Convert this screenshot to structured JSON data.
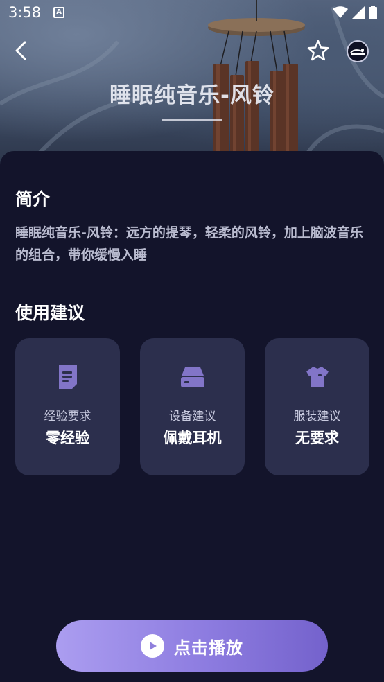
{
  "status_bar": {
    "time": "3:58",
    "notification_glyph": "A",
    "icons": [
      "wifi-icon",
      "signal-icon",
      "battery-icon"
    ]
  },
  "header": {
    "title": "睡眠纯音乐-风铃",
    "back_icon": "back-chevron-icon",
    "favorite_icon": "star-outline-icon",
    "avatar_icon": "sleep-avatar-icon"
  },
  "intro": {
    "heading": "简介",
    "text": "睡眠纯音乐-风铃：远方的提琴，轻柔的风铃，加上脑波音乐的组合，带你缓慢入睡"
  },
  "suggestions": {
    "heading": "使用建议",
    "cards": [
      {
        "icon": "document-icon",
        "label": "经验要求",
        "value": "零经验"
      },
      {
        "icon": "device-drive-icon",
        "label": "设备建议",
        "value": "佩戴耳机"
      },
      {
        "icon": "tshirt-icon",
        "label": "服装建议",
        "value": "无要求"
      }
    ]
  },
  "play": {
    "label": "点击播放",
    "icon": "play-circle-icon"
  },
  "colors": {
    "background": "#13142b",
    "card": "#2c2f4d",
    "accent": "#8f7fdc",
    "icon_accent": "#8275c8"
  }
}
